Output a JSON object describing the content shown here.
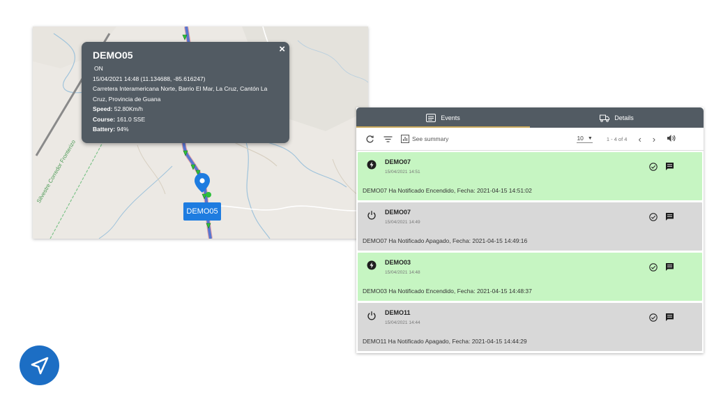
{
  "map": {
    "street_label": "Silvestre Corredor Fronterizo",
    "vehicle_label": "DEMO05"
  },
  "popup": {
    "title": "DEMO05",
    "status": "ON",
    "timestamp_coords": "15/04/2021 14:48 (11.134688, -85.616247)",
    "address": "Carretera Interamericana Norte, Barrio El Mar, La Cruz, Cantón La Cruz, Provincia de Guana",
    "speed_label": "Speed:",
    "speed_value": "52.80Km/h",
    "course_label": "Course:",
    "course_value": "161.0 SSE",
    "battery_label": "Battery:",
    "battery_value": "94%",
    "close_glyph": "×"
  },
  "panel": {
    "tabs": [
      {
        "label": "Events",
        "icon": "list-icon",
        "active": true
      },
      {
        "label": "Details",
        "icon": "truck-icon",
        "active": false
      }
    ],
    "toolbar": {
      "summary_label": "See summary",
      "page_size": "10",
      "range": "1 - 4 of 4"
    },
    "events": [
      {
        "name": "DEMO07",
        "time": "15/04/2021 14:51",
        "message": "DEMO07 Ha Notificado Encendido, Fecha: 2021-04-15 14:51:02",
        "type": "on",
        "icon": "ignition-on-icon"
      },
      {
        "name": "DEMO07",
        "time": "15/04/2021 14:49",
        "message": "DEMO07 Ha Notificado Apagado, Fecha: 2021-04-15 14:49:16",
        "type": "off",
        "icon": "power-icon"
      },
      {
        "name": "DEMO03",
        "time": "15/04/2021 14:48",
        "message": "DEMO03 Ha Notificado Encendido, Fecha: 2021-04-15 14:48:37",
        "type": "on",
        "icon": "ignition-on-icon"
      },
      {
        "name": "DEMO11",
        "time": "15/04/2021 14:44",
        "message": "DEMO11 Ha Notificado Apagado, Fecha: 2021-04-15 14:44:29",
        "type": "off",
        "icon": "power-icon"
      }
    ]
  },
  "colors": {
    "event_on_bg": "#c6f5c2",
    "event_off_bg": "#d8d8d8",
    "header_bg": "#525b63",
    "accent_blue": "#1e7ce0",
    "tab_underline": "#c9a95c"
  }
}
